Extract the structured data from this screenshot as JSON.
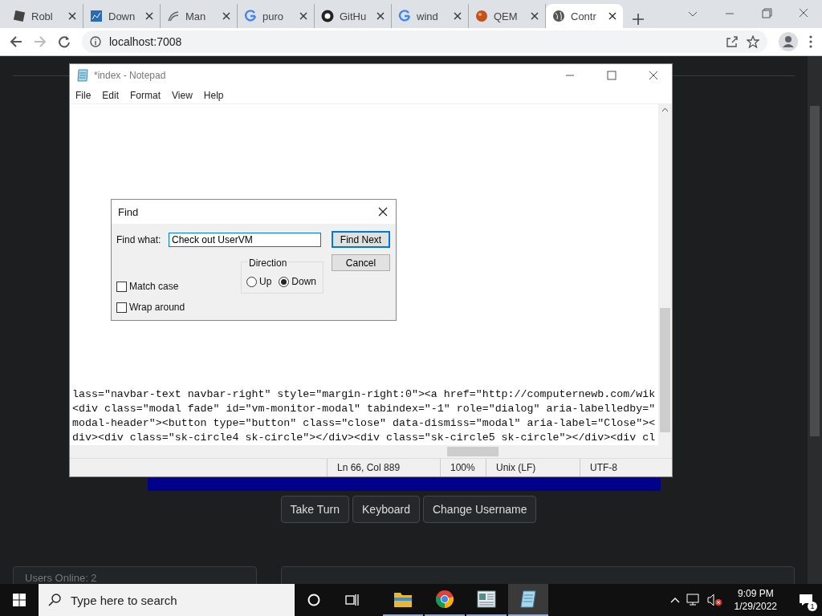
{
  "browser": {
    "tabs": [
      {
        "title": "Robl",
        "kind": "square",
        "selected": false
      },
      {
        "title": "Down",
        "kind": "chart",
        "selected": false
      },
      {
        "title": "Man",
        "kind": "wave",
        "selected": false
      },
      {
        "title": "puro",
        "kind": "g",
        "selected": false
      },
      {
        "title": "GitHu",
        "kind": "octo",
        "selected": false
      },
      {
        "title": "wind",
        "kind": "g",
        "selected": false
      },
      {
        "title": "QEM",
        "kind": "ball",
        "selected": false
      },
      {
        "title": "Contr",
        "kind": "globe",
        "selected": true
      }
    ],
    "address": "localhost:7008"
  },
  "page": {
    "buttons": [
      "Take Turn",
      "Keyboard",
      "Change Username"
    ],
    "users_online": "Users Online: 2"
  },
  "notepad": {
    "title": "*index - Notepad",
    "menu": [
      "File",
      "Edit",
      "Format",
      "View",
      "Help"
    ],
    "lines": [
      "lass=\"navbar-text navbar-right\" style=\"margin-right:0\"><a href=\"http://computernewb.com/wik",
      "<div class=\"modal fade\" id=\"vm-monitor-modal\" tabindex=\"-1\" role=\"dialog\" aria-labelledby=\"",
      "modal-header\"><button type=\"button\" class=\"close\" data-dismiss=\"modal\" aria-label=\"Close\"><",
      "div><div class=\"sk-circle4 sk-circle\"></div><div class=\"sk-circle5 sk-circle\"></div><div cl"
    ],
    "status": [
      "Ln 66, Col 889",
      "100%",
      "Unix (LF)",
      "UTF-8"
    ]
  },
  "find_dialog": {
    "title": "Find",
    "label": "Find what:",
    "value": "Check out UserVM",
    "buttons": [
      "Find Next",
      "Cancel"
    ],
    "direction_label": "Direction",
    "directions": [
      {
        "label": "Up",
        "selected": false
      },
      {
        "label": "Down",
        "selected": true
      }
    ],
    "options": [
      {
        "label": "Match case",
        "checked": false
      },
      {
        "label": "Wrap around",
        "checked": false
      }
    ]
  },
  "taskbar": {
    "search_placeholder": "Type here to search",
    "apps": [
      {
        "kind": "folder",
        "active": false
      },
      {
        "kind": "chrome",
        "active": false
      },
      {
        "kind": "reader",
        "active": false
      },
      {
        "kind": "notepad",
        "active": true
      }
    ],
    "time": "9:09 PM",
    "date": "1/29/2022",
    "notifications": "1"
  }
}
